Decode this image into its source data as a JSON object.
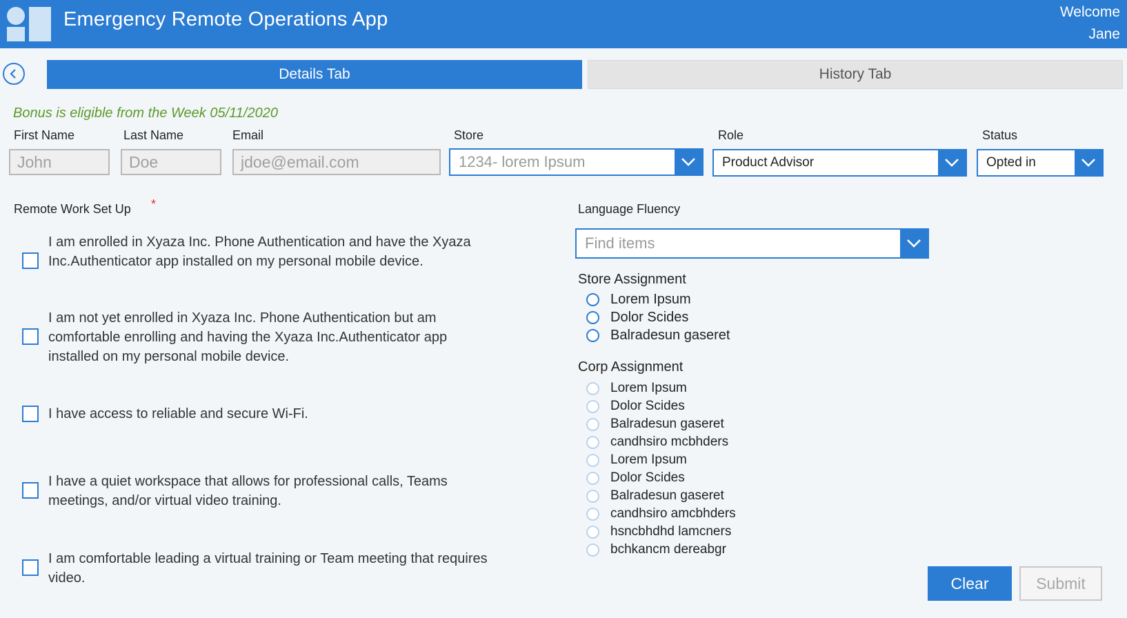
{
  "header": {
    "title": "Emergency Remote Operations App",
    "welcome_line1": "Welcome",
    "welcome_line2": "Jane"
  },
  "tabs": {
    "details": "Details Tab",
    "history": "History Tab",
    "active": "details"
  },
  "bonus_message": "Bonus is eligible from the Week 05/11/2020",
  "fields": {
    "first_name": {
      "label": "First Name",
      "value": "John"
    },
    "last_name": {
      "label": "Last Name",
      "value": "Doe"
    },
    "email": {
      "label": "Email",
      "value": "jdoe@email.com"
    },
    "store": {
      "label": "Store",
      "value": "1234- lorem Ipsum"
    },
    "role": {
      "label": "Role",
      "value": "Product Advisor"
    },
    "status": {
      "label": "Status",
      "value": "Opted in"
    }
  },
  "remote_setup": {
    "label": "Remote Work Set Up",
    "required_mark": "*",
    "items": [
      {
        "text": "I am enrolled in Xyaza Inc. Phone Authentication and have the Xyaza Inc.Authenticator app installed on my personal mobile device.",
        "checked": false
      },
      {
        "text": "I am not yet enrolled in Xyaza Inc. Phone Authentication but am comfortable enrolling and having the Xyaza Inc.Authenticator app installed on my personal mobile device.",
        "checked": false
      },
      {
        "text": "I have access to reliable and secure Wi-Fi.",
        "checked": false
      },
      {
        "text": "I have a quiet workspace that allows for professional calls, Teams meetings, and/or virtual video training.",
        "checked": false
      },
      {
        "text": "I am comfortable leading a virtual training or  Team meeting that requires video.",
        "checked": false
      }
    ]
  },
  "language_fluency": {
    "label": "Language Fluency",
    "placeholder": "Find items"
  },
  "store_assignment": {
    "label": "Store Assignment",
    "options": [
      "Lorem Ipsum",
      "Dolor Scides",
      "Balradesun gaseret"
    ]
  },
  "corp_assignment": {
    "label": "Corp Assignment",
    "options": [
      "Lorem Ipsum",
      "Dolor Scides",
      "Balradesun gaseret",
      "candhsiro mcbhders",
      "Lorem Ipsum",
      "Dolor Scides",
      "Balradesun gaseret",
      "candhsiro amcbhders",
      "hsncbhdhd lamcners",
      "bchkancm dereabgr"
    ]
  },
  "buttons": {
    "clear": "Clear",
    "submit": "Submit"
  },
  "icons": {
    "back": "chevron-left-icon",
    "dropdown": "chevron-down-icon",
    "logo": "app-logo-icon"
  },
  "colors": {
    "primary": "#2b7cd3",
    "bonus_text": "#5a9a2a",
    "required": "#dd3333",
    "background": "#f3f6f9"
  }
}
